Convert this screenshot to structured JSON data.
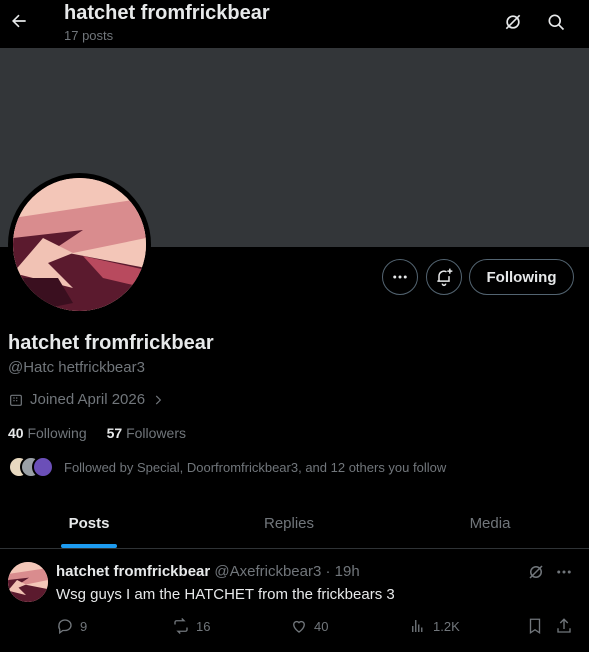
{
  "header": {
    "title": "hatchet fromfrickbear",
    "post_count": "17 posts",
    "back_icon": "arrow-left-icon",
    "grok_icon": "grok-icon",
    "search_icon": "search-icon"
  },
  "profile": {
    "display_name": "hatchet fromfrickbear",
    "handle": "@Hatc hetfrickbear3",
    "joined": "Joined April 2026",
    "following_count": "40",
    "following_label": "Following",
    "followers_count": "57",
    "followers_label": "Followers",
    "followed_by": "Followed by Special, Doorfromfrickbear3, and 12 others you follow"
  },
  "actions": {
    "more_icon": "more-icon",
    "notify_icon": "bell-plus-icon",
    "following_button": "Following"
  },
  "tabs": [
    {
      "label": "Posts",
      "active": true
    },
    {
      "label": "Replies",
      "active": false
    },
    {
      "label": "Media",
      "active": false
    }
  ],
  "post": {
    "author": "hatchet fromfrickbear",
    "meta": "@Axefrickbear3 · 19h",
    "text": "Wsg guys I am the HATCHET from the frickbears 3",
    "replies": "9",
    "reposts": "16",
    "likes": "40",
    "views": "1.2K"
  },
  "colors": {
    "background": "#000000",
    "banner": "#333639",
    "accent": "#1d9bf0",
    "muted": "#71767b",
    "text": "#e7e9ea"
  }
}
